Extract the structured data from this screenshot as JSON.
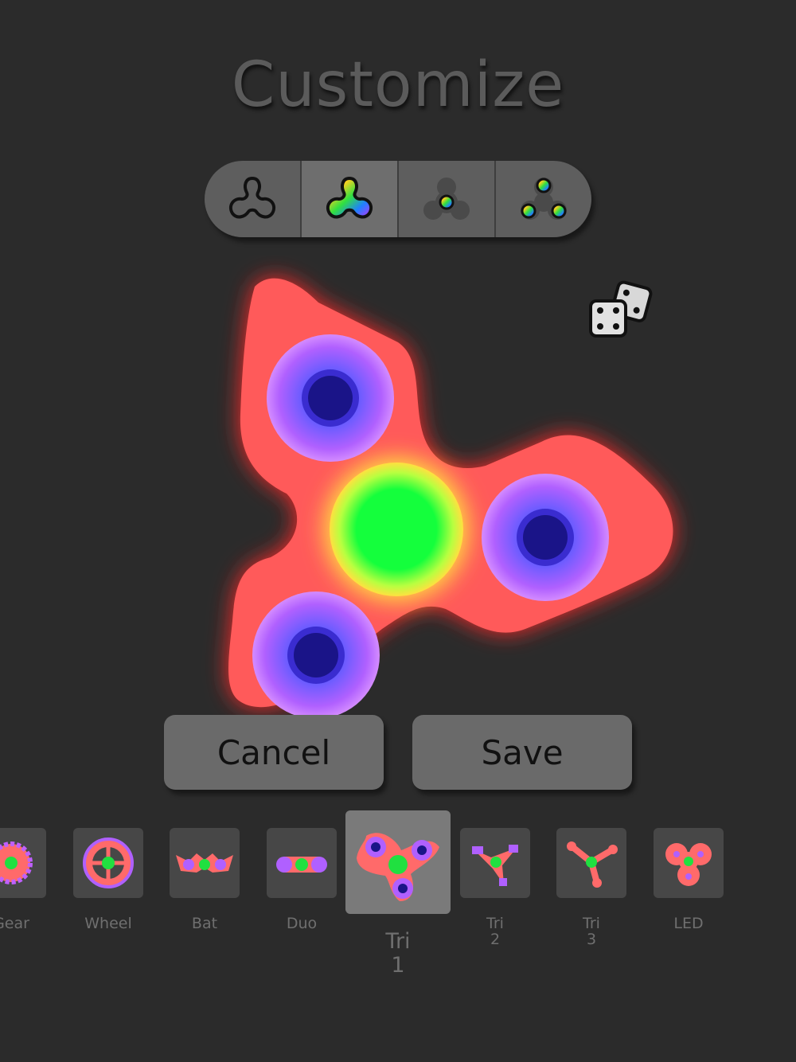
{
  "title": "Customize",
  "segments": [
    {
      "name": "outline-style",
      "icon": "spinner-outline-icon",
      "selected": false
    },
    {
      "name": "rainbow-style",
      "icon": "spinner-rainbow-body-icon",
      "selected": true
    },
    {
      "name": "gray-center-style",
      "icon": "spinner-rainbow-center-icon",
      "selected": false
    },
    {
      "name": "bearings-style",
      "icon": "spinner-rainbow-bearings-icon",
      "selected": false
    }
  ],
  "randomize_icon": "dice-icon",
  "preview": {
    "body_color": "#ff5a5a",
    "glow_color": "#ff1a1a",
    "center_color": "#1aff3a",
    "bearing_color": "#b06cff",
    "hole_color": "#1a1488"
  },
  "buttons": {
    "cancel": "Cancel",
    "save": "Save"
  },
  "carousel": [
    {
      "label": "Gear",
      "selected": false
    },
    {
      "label": "Wheel",
      "selected": false
    },
    {
      "label": "Bat",
      "selected": false
    },
    {
      "label": "Duo",
      "selected": false
    },
    {
      "label": "Tri\n1",
      "selected": true
    },
    {
      "label": "Tri\n2",
      "selected": false
    },
    {
      "label": "Tri\n3",
      "selected": false
    },
    {
      "label": "LED",
      "selected": false
    }
  ]
}
